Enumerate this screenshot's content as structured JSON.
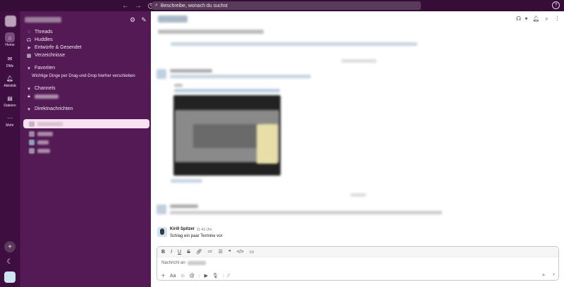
{
  "topbar": {
    "back_icon": "arrow-left-icon",
    "forward_icon": "arrow-right-icon",
    "history_icon": "clock-icon",
    "search_placeholder": "Beschreibe, wonach du suchst",
    "help_icon": "question-circle-icon"
  },
  "rail": {
    "items": [
      {
        "label": "Home",
        "icon": "home-icon"
      },
      {
        "label": "DMs",
        "icon": "dm-icon"
      },
      {
        "label": "Aktivität",
        "icon": "bell-icon"
      },
      {
        "label": "Dateien",
        "icon": "files-icon"
      },
      {
        "label": "Mehr",
        "icon": "more-icon"
      }
    ]
  },
  "sidebar": {
    "top_items": [
      {
        "label": "Threads",
        "icon": "threads-icon"
      },
      {
        "label": "Huddles",
        "icon": "headphones-icon"
      },
      {
        "label": "Entwürfe & Gesendet",
        "icon": "send-icon"
      },
      {
        "label": "Verzeichnisse",
        "icon": "directory-icon"
      }
    ],
    "favorites": {
      "label": "Favoriten",
      "hint": "Wichtige Dinge per Drag-und-Drop hierher verschieben"
    },
    "channels": {
      "label": "Channels"
    },
    "direct_messages": {
      "label": "Direktnachrichten"
    }
  },
  "message": {
    "author": "Kirill Spitzer",
    "time": "11:43 Uhr",
    "text": "Schlag ein paar Termine vor"
  },
  "composer": {
    "placeholder_prefix": "Nachricht an",
    "format_buttons": [
      "B",
      "I",
      "U",
      "S"
    ],
    "text_format_label": "Aa"
  },
  "colors": {
    "sidebar": "#541a55",
    "rail": "#3f0e40",
    "active_dm": "#f9e3f2"
  }
}
